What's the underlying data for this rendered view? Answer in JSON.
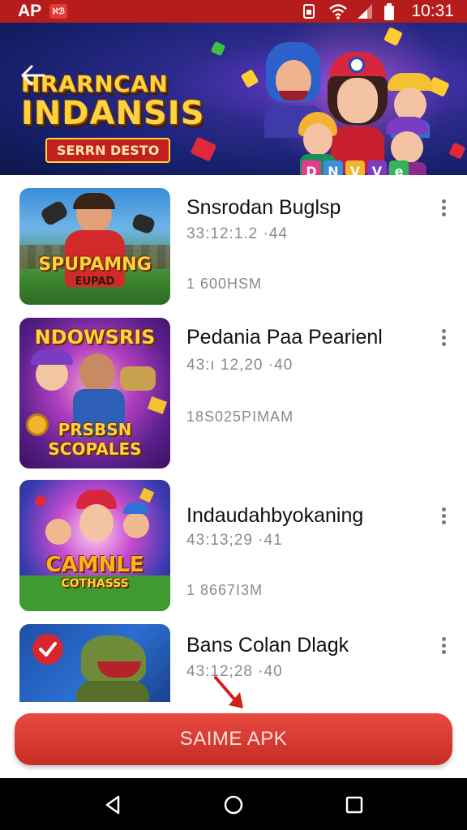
{
  "status_bar": {
    "carrier": "AP",
    "carrier_badge_text": "ℵℬ",
    "time": "10:31",
    "icons": [
      "sim-icon",
      "wifi-icon",
      "signal-icon",
      "battery-icon"
    ]
  },
  "banner": {
    "title_line1": "HRARNCAN",
    "title_line2": "INDANSIS",
    "subtitle": "SERRN DESTO",
    "blocks": [
      "D",
      "N",
      "V",
      "V",
      "e"
    ]
  },
  "games": [
    {
      "title": "Snsrodan Buglsp",
      "meta": "33:12:1.2  ·44",
      "size": "1 600HSM",
      "thumb_title_1": "SPUPAMNG",
      "thumb_title_2": "EUPAD"
    },
    {
      "title": "Pedania Paa Pearienl",
      "meta": "43:ı 12,20  ·40",
      "size": "18S025PIMAM",
      "thumb_title_1": "NDOWSRIS",
      "thumb_title_2": "PRSBSN",
      "thumb_title_3": "SCOPALES"
    },
    {
      "title": "Indaudahbyokaning",
      "meta": "43:13;29  ·41",
      "size": "1 8667I3M",
      "thumb_title_1": "CAMNLE",
      "thumb_title_2": "COTHASSS"
    },
    {
      "title": "Bans Colan Dlagk",
      "meta": "43:12;28  ·40"
    }
  ],
  "bottom": {
    "button_label": "SAIME APK"
  },
  "colors": {
    "status_bar": "#b71c1c",
    "button": "#d63a31",
    "accent_yellow": "#ffd23f"
  }
}
